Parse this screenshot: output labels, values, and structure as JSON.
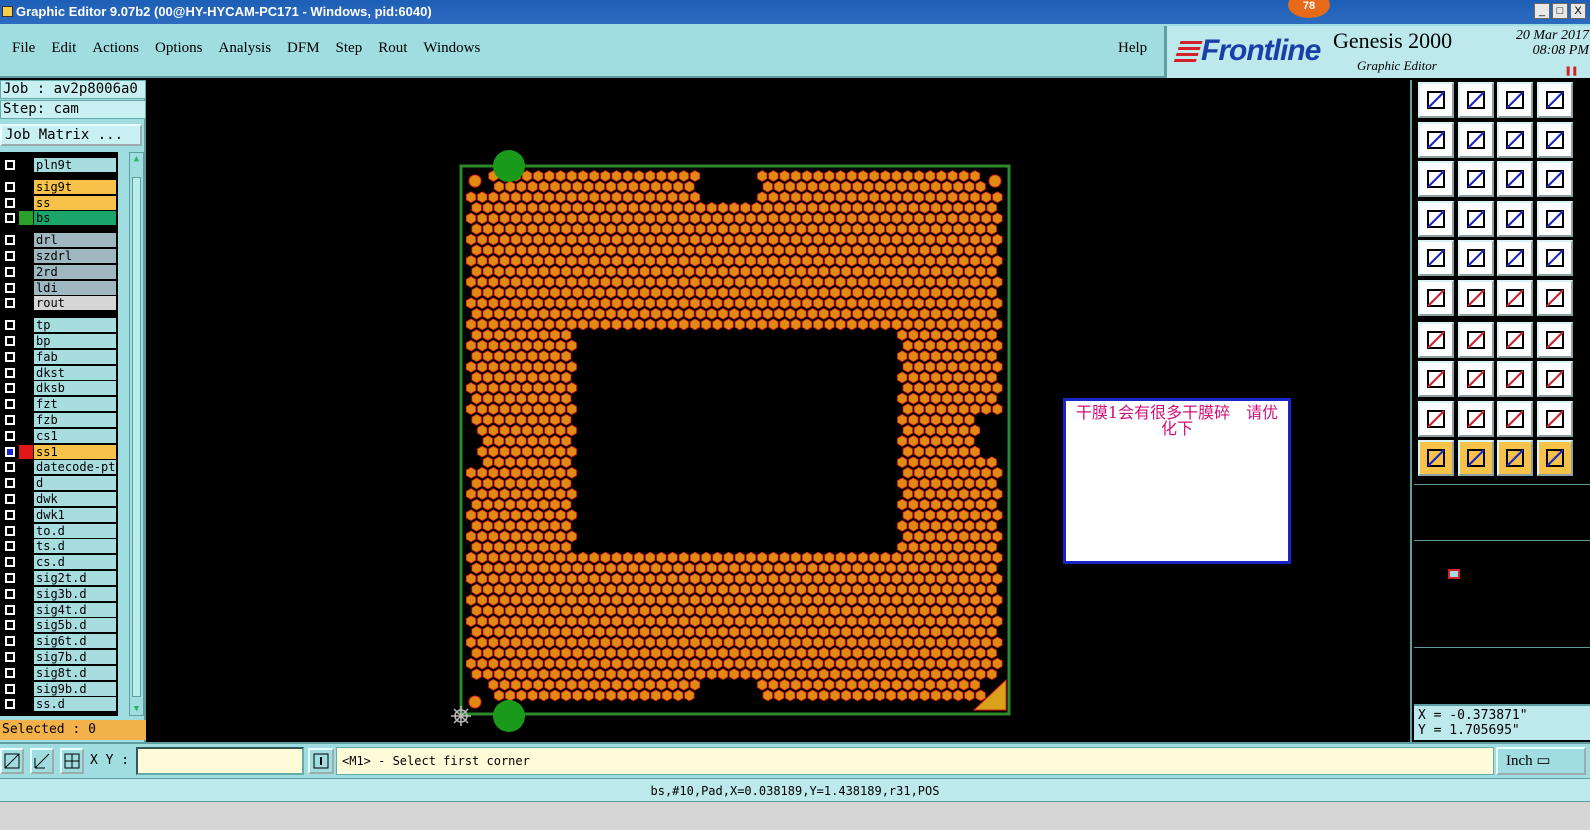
{
  "window": {
    "title": "Graphic Editor 9.07b2 (00@HY-HYCAM-PC171 - Windows, pid:6040)",
    "badge": "78",
    "min": "_",
    "max": "□",
    "close": "X"
  },
  "menu": {
    "items": [
      "File",
      "Edit",
      "Actions",
      "Options",
      "Analysis",
      "DFM",
      "Step",
      "Rout",
      "Windows"
    ],
    "help": "Help"
  },
  "brand": {
    "logo": "Frontline",
    "product": "Genesis 2000",
    "subtitle": "Graphic Editor",
    "date": "20 Mar 2017",
    "time": "08:08 PM"
  },
  "job": {
    "job_label": "Job : av2p8006a0",
    "step_label": "Step: cam",
    "matrix_button": "Job Matrix ..."
  },
  "layers": [
    {
      "name": "pln9t",
      "color": "#a8dde0"
    },
    {
      "name": "sig9t",
      "color": "#f6c24a"
    },
    {
      "name": "ss",
      "color": "#f6c24a"
    },
    {
      "name": "bs",
      "color": "#1aa56a",
      "swatch": "#2aa02a"
    },
    {
      "name": "drl",
      "color": "#9fb8c0"
    },
    {
      "name": "szdrl",
      "color": "#9fb8c0"
    },
    {
      "name": "2rd",
      "color": "#9fb8c0"
    },
    {
      "name": "ldi",
      "color": "#9fb8c0"
    },
    {
      "name": "rout",
      "color": "#d6d6d6"
    },
    {
      "name": "tp",
      "color": "#a8dde0"
    },
    {
      "name": "bp",
      "color": "#a8dde0"
    },
    {
      "name": "fab",
      "color": "#a8dde0"
    },
    {
      "name": "dkst",
      "color": "#a8dde0"
    },
    {
      "name": "dksb",
      "color": "#a8dde0"
    },
    {
      "name": "fzt",
      "color": "#a8dde0"
    },
    {
      "name": "fzb",
      "color": "#a8dde0"
    },
    {
      "name": "cs1",
      "color": "#a8dde0"
    },
    {
      "name": "ss1",
      "color": "#f6c24a",
      "swatch": "#e01818",
      "checked": true
    },
    {
      "name": "datecode-ptc",
      "color": "#a8dde0"
    },
    {
      "name": "d",
      "color": "#a8dde0"
    },
    {
      "name": "dwk",
      "color": "#a8dde0"
    },
    {
      "name": "dwk1",
      "color": "#a8dde0"
    },
    {
      "name": "to.d",
      "color": "#a8dde0"
    },
    {
      "name": "ts.d",
      "color": "#a8dde0"
    },
    {
      "name": "cs.d",
      "color": "#a8dde0"
    },
    {
      "name": "sig2t.d",
      "color": "#a8dde0"
    },
    {
      "name": "sig3b.d",
      "color": "#a8dde0"
    },
    {
      "name": "sig4t.d",
      "color": "#a8dde0"
    },
    {
      "name": "sig5b.d",
      "color": "#a8dde0"
    },
    {
      "name": "sig6t.d",
      "color": "#a8dde0"
    },
    {
      "name": "sig7b.d",
      "color": "#a8dde0"
    },
    {
      "name": "sig8t.d",
      "color": "#a8dde0"
    },
    {
      "name": "sig9b.d",
      "color": "#a8dde0"
    },
    {
      "name": "ss.d",
      "color": "#a8dde0"
    }
  ],
  "selected": "Selected : 0",
  "note": {
    "text": "干膜1会有很多干膜碎　请优化下"
  },
  "coords": {
    "x": "X = -0.373871\"",
    "y": "Y = 1.705695\""
  },
  "bottom": {
    "xy_label": "X Y :",
    "xy_value": "",
    "prompt": "<M1> - Select first corner",
    "unit": "Inch"
  },
  "status": "bs,#10,Pad,X=0.038189,Y=1.438189,r31,POS",
  "colors": {
    "panel": "#9fdde0",
    "pad": "#e08a12",
    "pad_edge": "#e02020",
    "outline": "#2a8a2a",
    "fiducial": "#1a9a1a"
  }
}
